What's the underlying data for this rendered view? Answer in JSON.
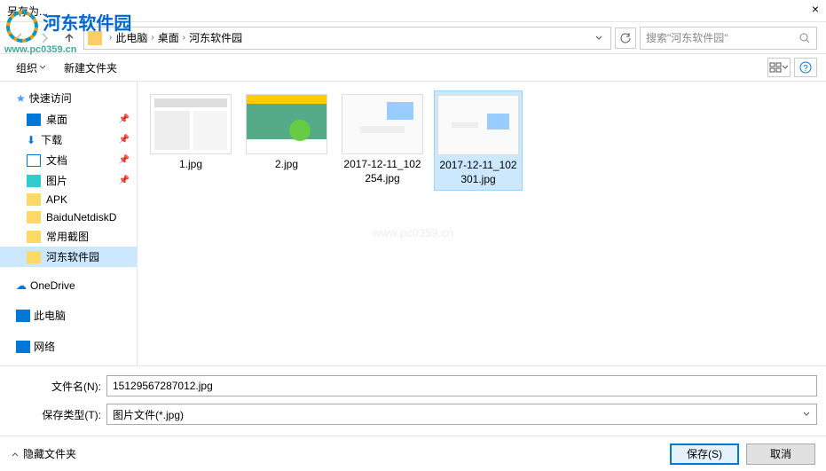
{
  "title": "另存为...",
  "watermark": {
    "main": "河东软件园",
    "sub": "www.pc0359.cn"
  },
  "breadcrumb": {
    "root": "此电脑",
    "items": [
      "桌面",
      "河东软件园"
    ]
  },
  "search": {
    "placeholder": "搜索\"河东软件园\""
  },
  "toolbar": {
    "organize": "组织",
    "newfolder": "新建文件夹"
  },
  "sidebar": {
    "quick": {
      "label": "快速访问",
      "items": [
        {
          "label": "桌面",
          "pinned": true,
          "icon": "desktop"
        },
        {
          "label": "下载",
          "pinned": true,
          "icon": "download"
        },
        {
          "label": "文档",
          "pinned": true,
          "icon": "doc"
        },
        {
          "label": "图片",
          "pinned": true,
          "icon": "pic"
        },
        {
          "label": "APK",
          "pinned": false,
          "icon": "folder"
        },
        {
          "label": "BaiduNetdiskD",
          "pinned": false,
          "icon": "folder"
        },
        {
          "label": "常用截图",
          "pinned": false,
          "icon": "folder"
        },
        {
          "label": "河东软件园",
          "pinned": false,
          "icon": "folder",
          "selected": true
        }
      ]
    },
    "onedrive": {
      "label": "OneDrive"
    },
    "thispc": {
      "label": "此电脑"
    },
    "network": {
      "label": "网络"
    }
  },
  "files": [
    {
      "name": "1.jpg",
      "selected": false
    },
    {
      "name": "2.jpg",
      "selected": false
    },
    {
      "name": "2017-12-11_102254.jpg",
      "selected": false
    },
    {
      "name": "2017-12-11_102301.jpg",
      "selected": true
    }
  ],
  "form": {
    "filename_label": "文件名(N):",
    "filename_value": "15129567287012.jpg",
    "filetype_label": "保存类型(T):",
    "filetype_value": "图片文件(*.jpg)"
  },
  "bottom": {
    "hide_folders": "隐藏文件夹",
    "save": "保存(S)",
    "cancel": "取消"
  },
  "center_wm": "www.pc0359.cn"
}
